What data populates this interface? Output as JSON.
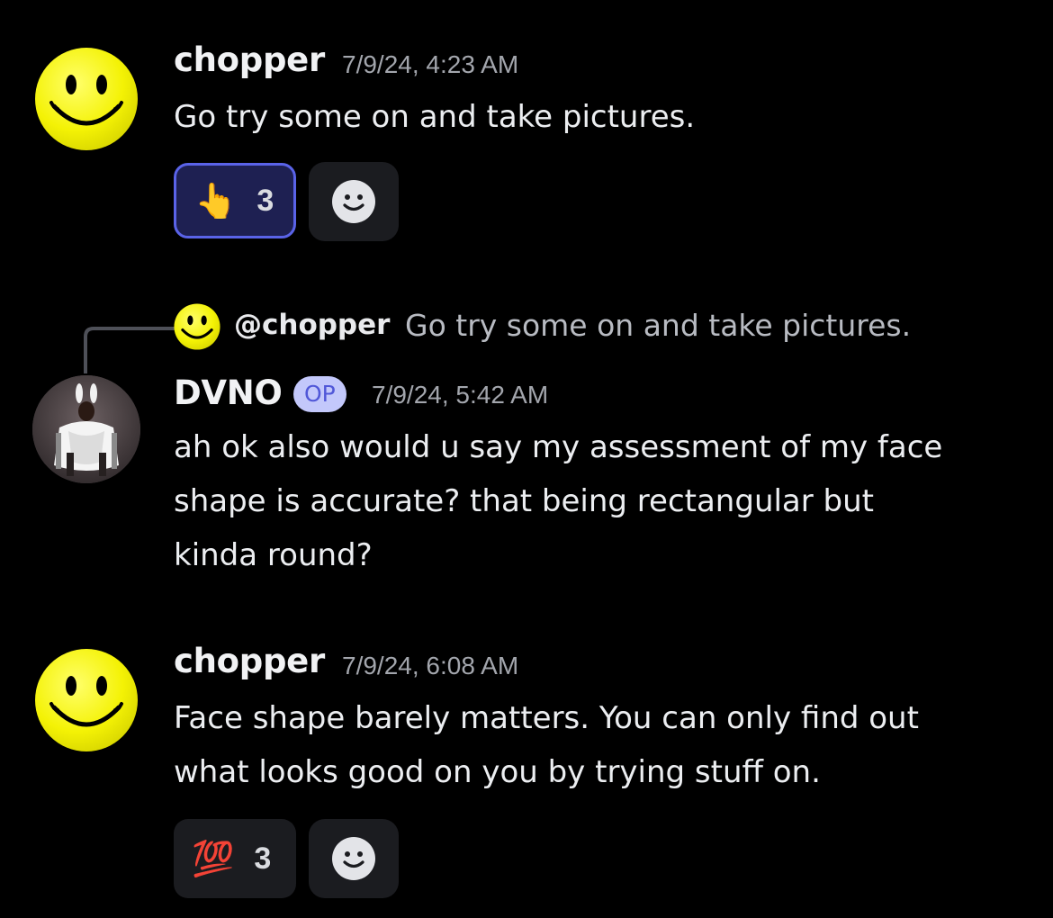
{
  "messages": [
    {
      "author": "chopper",
      "timestamp": "7/9/24, 4:23 AM",
      "lines": [
        "Go try some on and take pictures."
      ],
      "avatar_icon": "smiley-face-icon",
      "reaction": {
        "emoji": "👆",
        "emoji_name": "pointing-up-icon",
        "count": "3",
        "active": true
      }
    },
    {
      "reply_to": {
        "mention": "@chopper",
        "text": "Go try some on and take pictures."
      },
      "author": "DVNO",
      "badge": "OP",
      "timestamp": "7/9/24, 5:42 AM",
      "lines": [
        "ah ok also would u say my assessment of my face",
        "shape is accurate? that being rectangular but",
        "kinda round?"
      ],
      "avatar_icon": "profile-photo"
    },
    {
      "author": "chopper",
      "timestamp": "7/9/24, 6:08 AM",
      "lines": [
        "Face shape barely matters. You can only find out",
        "what looks good on you by trying stuff on."
      ],
      "avatar_icon": "smiley-face-icon",
      "reaction": {
        "emoji": "💯",
        "emoji_name": "hundred-points-icon",
        "count": "3",
        "active": false
      }
    }
  ],
  "colors": {
    "background": "#000000",
    "accent": "#5a63e8",
    "op_badge_bg": "#c3c8fb",
    "smiley_yellow": "#f4f205"
  }
}
